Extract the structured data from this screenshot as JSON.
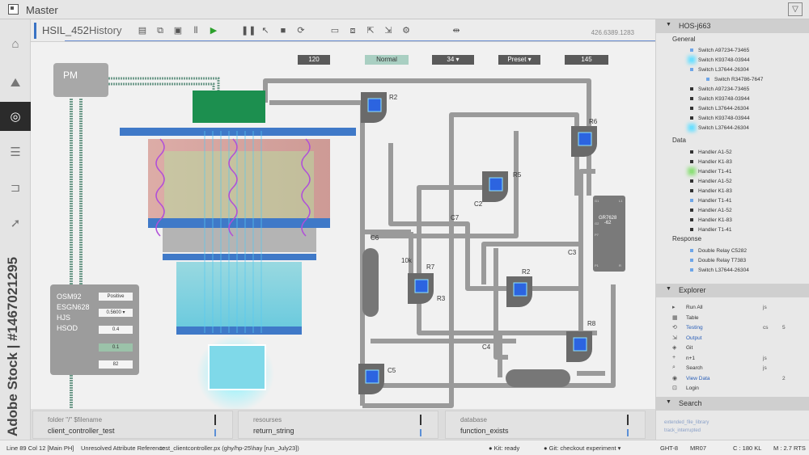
{
  "window": {
    "title": "Master"
  },
  "tabs": {
    "file": "HSIL_452",
    "history": "History",
    "coord": "426.6389.1283"
  },
  "toolbar_icons": [
    "print-icon",
    "node-icon",
    "save-icon",
    "align-icon",
    "run-icon",
    "pause-icon",
    "cursor-icon",
    "stop-icon",
    "loop-icon",
    "layer-icon",
    "stack-icon",
    "export-icon",
    "import-icon",
    "settings-icon",
    "link-icon"
  ],
  "controls": {
    "c1": "120",
    "mode": "Normal",
    "c3": "34",
    "preset": "Preset",
    "c5": "145"
  },
  "pm": "PM",
  "left_panel": {
    "labels": [
      "OSM92",
      "ESGN628",
      "HJS",
      "HSOD"
    ],
    "values": [
      "Positive",
      "0.5600",
      "0.4",
      "0.1",
      "82"
    ]
  },
  "components": {
    "r2a": "R2",
    "r6": "R6",
    "r5": "R5",
    "c2": "C2",
    "c7": "C7",
    "c6": "C6",
    "k10": "10k",
    "r7": "R7",
    "r3": "R3",
    "r2b": "R2",
    "c3": "C3",
    "r8": "R8",
    "c4": "C4",
    "c5": "C5",
    "chip": "GR7628\n-62",
    "chip_pins": [
      "G1",
      "L1",
      "G2",
      "P7",
      "P1",
      "R"
    ]
  },
  "bottom_panels": [
    {
      "header": "folder \"/\" $filename",
      "value": "client_controller_test"
    },
    {
      "header": "resourses",
      "value": "return_string"
    },
    {
      "header": "database",
      "value": "function_exists"
    }
  ],
  "status": {
    "line": "Line 89 Col 12 [Main PH]",
    "error": "Unresolved Attribute Reference",
    "file": "test_clientcontroller.px (ghy/hp-25\\hay [run_July23])",
    "kit": "Kit: ready",
    "git": "Git: checkout experiment",
    "ght": "GHT-8",
    "mr": "MR07",
    "c": "C : 180 KL",
    "m": "M : 2.7 RTS"
  },
  "sidebar": {
    "title": "HOS-j663",
    "general_label": "General",
    "general": [
      {
        "t": "Switch A97234-73465",
        "d": "b"
      },
      {
        "t": "Switch K93748-03944",
        "d": "glowb"
      },
      {
        "t": "Switch L37644-26304",
        "d": "b"
      },
      {
        "t": "Switch R34786-7647",
        "d": "b"
      },
      {
        "t": "Switch A97234-73465",
        "d": "k"
      },
      {
        "t": "Switch K93748-03944",
        "d": "k"
      },
      {
        "t": "Switch L37644-26304",
        "d": "k"
      },
      {
        "t": "Switch K93748-03944",
        "d": "k"
      },
      {
        "t": "Switch L37644-26304",
        "d": "glowb"
      }
    ],
    "data_label": "Data",
    "data": [
      {
        "t": "Handler A1-52",
        "d": "k"
      },
      {
        "t": "Handler K1-83",
        "d": "k"
      },
      {
        "t": "Handler T1-41",
        "d": "glowg"
      },
      {
        "t": "Handler A1-52",
        "d": "k"
      },
      {
        "t": "Handler K1-83",
        "d": "k"
      },
      {
        "t": "Handler T1-41",
        "d": "b"
      },
      {
        "t": "Handler A1-52",
        "d": "k"
      },
      {
        "t": "Handler K1-83",
        "d": "k"
      },
      {
        "t": "Handler T1-41",
        "d": "k"
      }
    ],
    "response_label": "Response",
    "response": [
      {
        "t": "Double Relay C5282",
        "d": "b"
      },
      {
        "t": "Double Relay T7383",
        "d": "b"
      },
      {
        "t": "Switch L37644-26304",
        "d": "b"
      }
    ],
    "explorer_title": "Explorer",
    "explorer": [
      {
        "icon": "▸",
        "name": "Run All",
        "ext": "js",
        "num": "",
        "blue": false
      },
      {
        "icon": "▦",
        "name": "Table",
        "ext": "",
        "num": "",
        "blue": false
      },
      {
        "icon": "⟲",
        "name": "Testing",
        "ext": "cs",
        "num": "5",
        "blue": true
      },
      {
        "icon": "⇲",
        "name": "Output",
        "ext": "",
        "num": "",
        "blue": true
      },
      {
        "icon": "◈",
        "name": "Git",
        "ext": "",
        "num": "",
        "blue": false
      },
      {
        "icon": "+",
        "name": "n+1",
        "ext": "js",
        "num": "",
        "blue": false
      },
      {
        "icon": "⌕",
        "name": "Search",
        "ext": "js",
        "num": "",
        "blue": false
      },
      {
        "icon": "◉",
        "name": "View Data",
        "ext": "",
        "num": "2",
        "blue": true
      },
      {
        "icon": "⊡",
        "name": "Login",
        "ext": "",
        "num": "",
        "blue": false
      }
    ],
    "search_title": "Search",
    "search_results": [
      "extended_file_library",
      "track_interrupted"
    ]
  },
  "watermark": "Adobe Stock | #1467021295"
}
